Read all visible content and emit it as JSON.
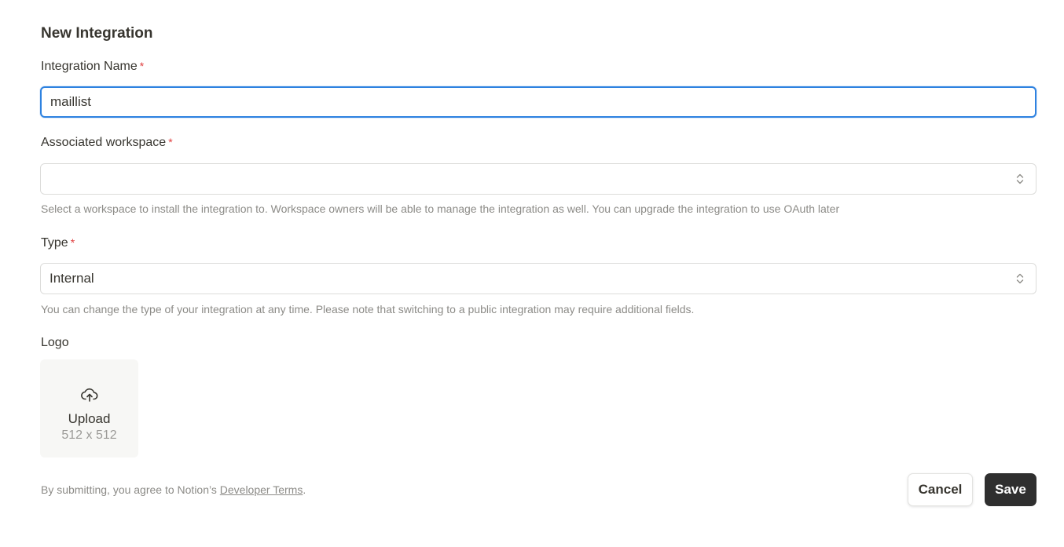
{
  "form": {
    "title": "New Integration",
    "required_marker": "*",
    "name_field": {
      "label": "Integration Name",
      "value": "maillist"
    },
    "workspace_field": {
      "label": "Associated workspace",
      "value": "",
      "hint": "Select a workspace to install the integration to. Workspace owners will be able to manage the integration as well. You can upgrade the integration to use OAuth later"
    },
    "type_field": {
      "label": "Type",
      "value": "Internal",
      "hint": "You can change the type of your integration at any time. Please note that switching to a public integration may require additional fields."
    },
    "logo_field": {
      "label": "Logo",
      "upload_label": "Upload",
      "upload_size": "512 x 512"
    }
  },
  "footer": {
    "terms_prefix": "By submitting, you agree to Notion’s ",
    "terms_link": "Developer Terms",
    "terms_suffix": ".",
    "cancel_label": "Cancel",
    "save_label": "Save"
  },
  "colors": {
    "focus_border": "#2e82e0",
    "required": "#e03e3e",
    "save_bg": "#2f2f2f"
  },
  "icons": {
    "upload": "cloud-upload-icon",
    "select_chevron": "chevron-up-down-icon"
  }
}
